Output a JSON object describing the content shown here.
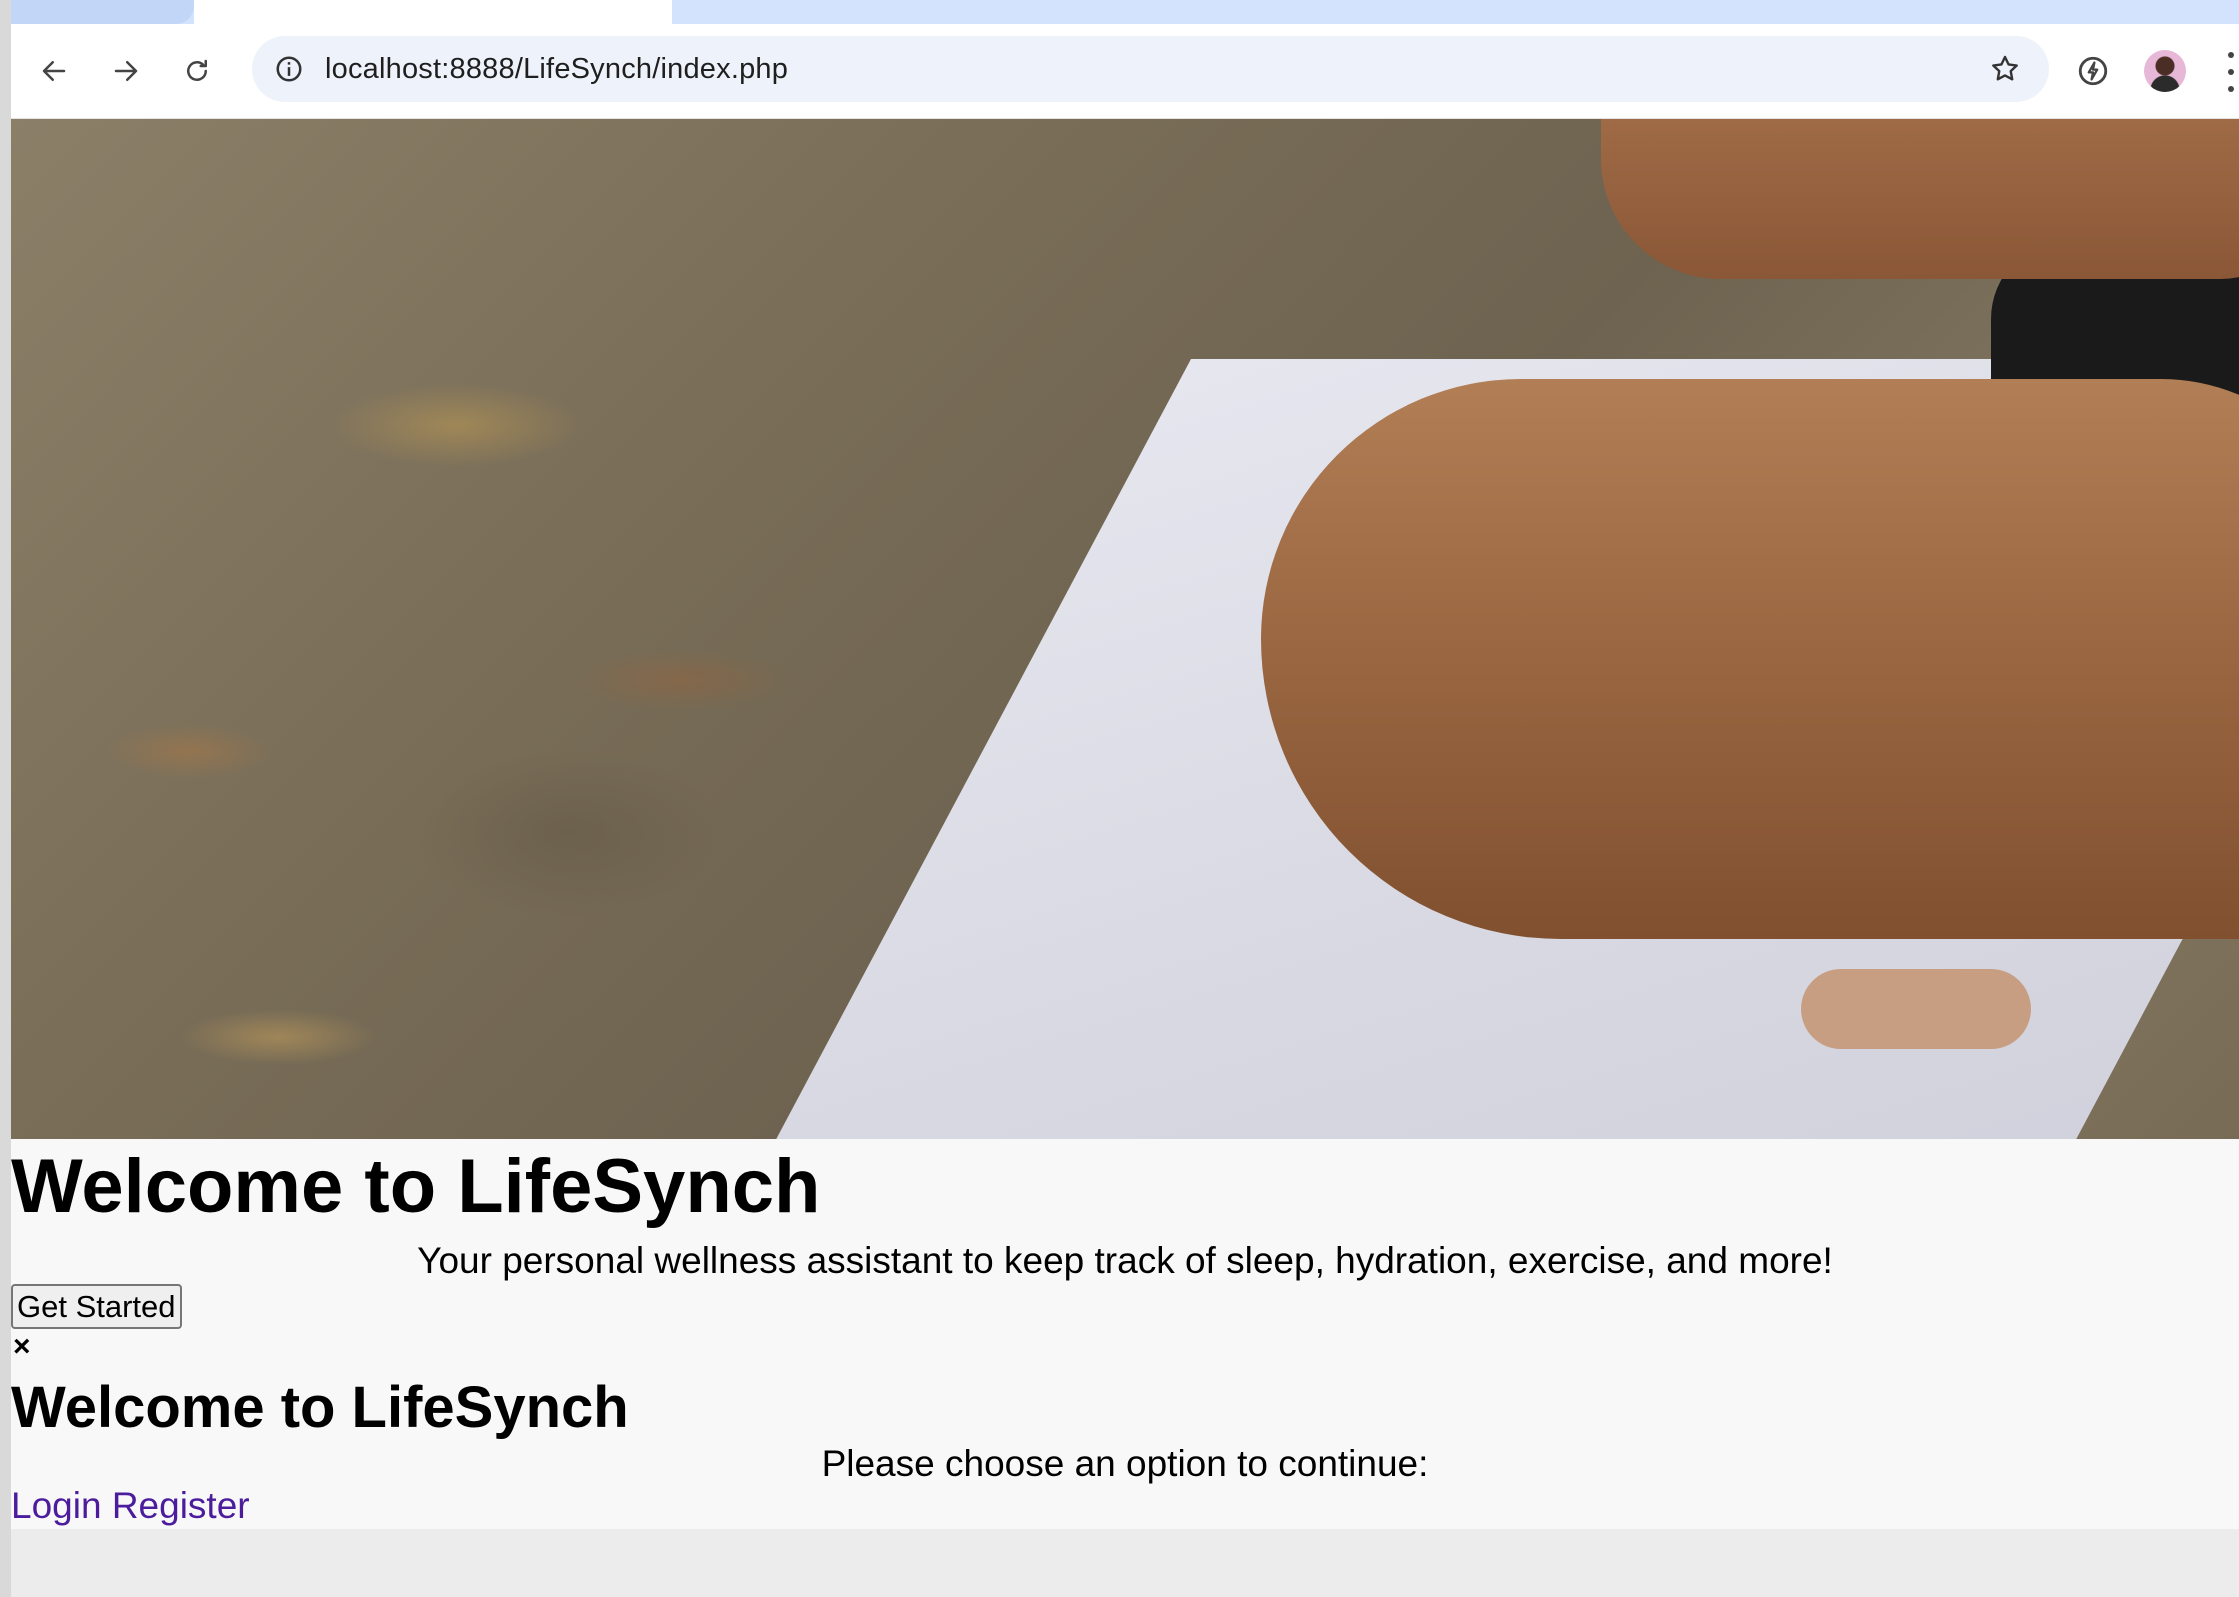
{
  "browser": {
    "url": "localhost:8888/LifeSynch/index.php"
  },
  "hero": {
    "title": "Welcome to LifeSynch",
    "subtitle": "Your personal wellness assistant to keep track of sleep, hydration, exercise, and more!",
    "cta_label": "Get Started"
  },
  "modal": {
    "close_label": "×",
    "title": "Welcome to LifeSynch",
    "prompt": "Please choose an option to continue:",
    "login_label": "Login",
    "register_label": "Register"
  },
  "colors": {
    "link": "#4b1d9c",
    "tab_strip": "#d3e3fd",
    "omnibox": "#eef2fa",
    "page_bg": "#f8f8f8"
  }
}
